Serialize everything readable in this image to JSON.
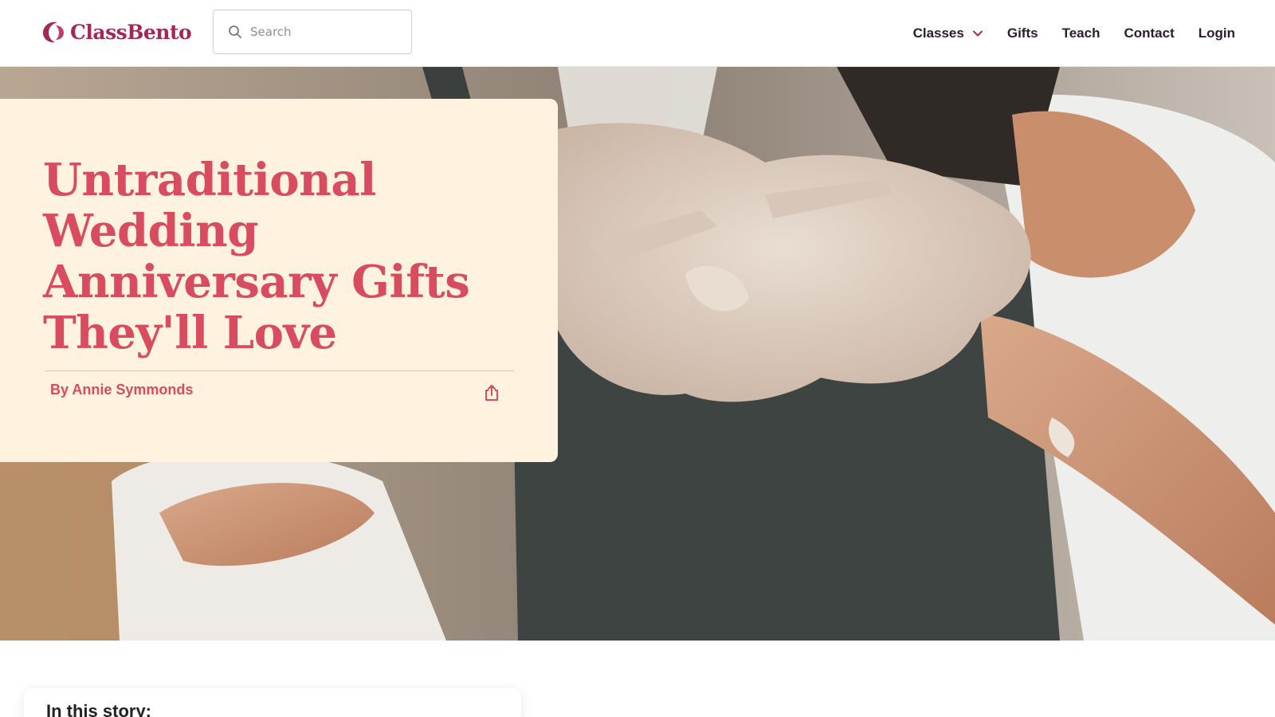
{
  "brand": {
    "name": "ClassBento",
    "color": "#a2285a"
  },
  "search": {
    "placeholder": "Search"
  },
  "nav": {
    "items": [
      {
        "label": "Classes",
        "has_dropdown": true
      },
      {
        "label": "Gifts"
      },
      {
        "label": "Teach"
      },
      {
        "label": "Contact"
      },
      {
        "label": "Login"
      }
    ]
  },
  "hero": {
    "title": "Untraditional Wedding Anniversary Gifts They'll Love",
    "author": "By Annie Symmonds",
    "title_color": "#d94b5e",
    "card_color": "#fff2df"
  },
  "story": {
    "heading": "In this story:"
  },
  "icons": {
    "search": "search-icon",
    "dropdown": "chevron-down-icon",
    "share": "share-icon"
  }
}
